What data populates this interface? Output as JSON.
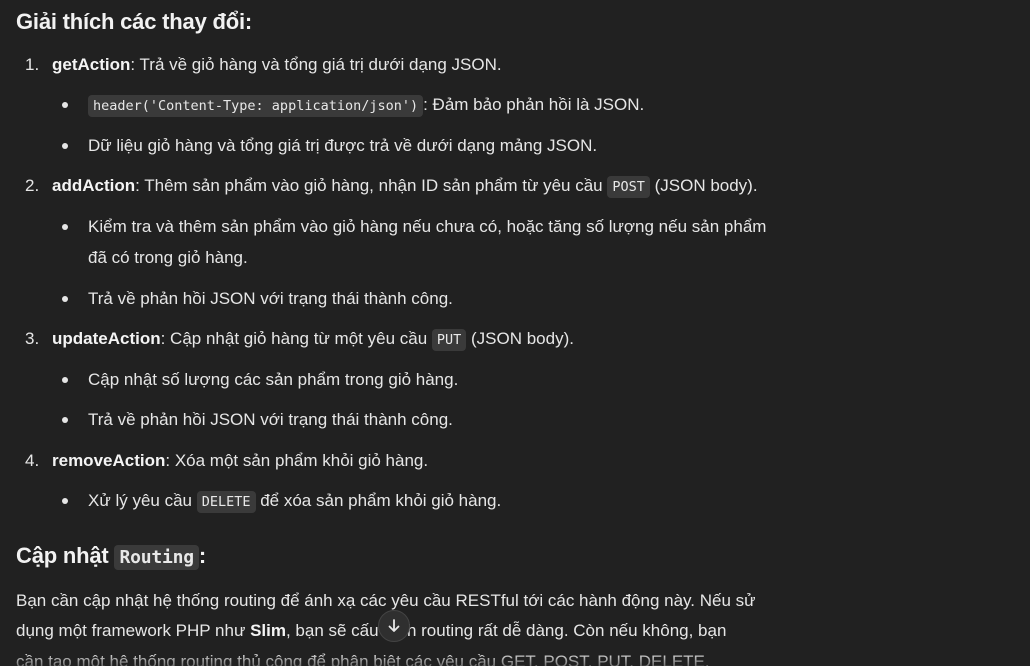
{
  "heading": "Giải thích các thay đổi:",
  "items": [
    {
      "number": "1.",
      "name": "getAction",
      "text": ": Trả về giỏ hàng và tổng giá trị dưới dạng JSON.",
      "bullets": [
        {
          "code": "header('Content-Type: application/json')",
          "text": ": Đảm bảo phản hồi là JSON."
        },
        {
          "text": "Dữ liệu giỏ hàng và tổng giá trị được trả về dưới dạng mảng JSON."
        }
      ]
    },
    {
      "number": "2.",
      "name": "addAction",
      "text_before": ": Thêm sản phẩm vào giỏ hàng, nhận ID sản phẩm từ yêu cầu ",
      "code": "POST",
      "text_after": " (JSON body).",
      "bullets": [
        {
          "text_line1": "Kiểm tra và thêm sản phẩm vào giỏ hàng nếu chưa có, hoặc tăng số lượng nếu sản phẩm",
          "text_line2": "đã có trong giỏ hàng."
        },
        {
          "text": "Trả về phản hồi JSON với trạng thái thành công."
        }
      ]
    },
    {
      "number": "3.",
      "name": "updateAction",
      "text_before": ": Cập nhật giỏ hàng từ một yêu cầu ",
      "code": "PUT",
      "text_after": " (JSON body).",
      "bullets": [
        {
          "text": "Cập nhật số lượng các sản phẩm trong giỏ hàng."
        },
        {
          "text": "Trả về phản hồi JSON với trạng thái thành công."
        }
      ]
    },
    {
      "number": "4.",
      "name": "removeAction",
      "text": ": Xóa một sản phẩm khỏi giỏ hàng.",
      "bullets": [
        {
          "text_before": "Xử lý yêu cầu ",
          "code": "DELETE",
          "text_after": " để xóa sản phẩm khỏi giỏ hàng."
        }
      ]
    }
  ],
  "routing_heading": {
    "text": "Cập nhật ",
    "code": "Routing",
    "suffix": ":"
  },
  "paragraph": {
    "line1": "Bạn cần cập nhật hệ thống routing để ánh xạ các yêu cầu RESTful tới các hành động này. Nếu sử",
    "line2_before": "dụng một framework PHP như ",
    "line2_bold": "Slim",
    "line2_after": ", bạn sẽ cấu hình routing rất dễ dàng. Còn nếu không, bạn",
    "line3": "cần tạo một hệ thống routing thủ công để phân biệt các yêu cầu GET, POST, PUT, DELETE."
  },
  "scroll_button": {
    "icon": "arrow-down-icon"
  }
}
